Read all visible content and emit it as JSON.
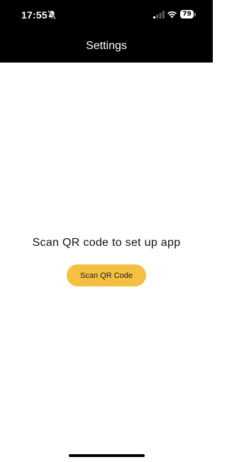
{
  "status_bar": {
    "time": "17:55",
    "battery_level": "79",
    "icons": [
      "bell-slash-icon",
      "cellular-signal-icon",
      "wifi-icon",
      "battery-icon"
    ]
  },
  "header": {
    "title": "Settings"
  },
  "main": {
    "prompt": "Scan QR code to set up app",
    "scan_button_label": "Scan QR Code"
  },
  "colors": {
    "header_background": "#000000",
    "accent": "#f4c042",
    "background": "#ffffff"
  }
}
